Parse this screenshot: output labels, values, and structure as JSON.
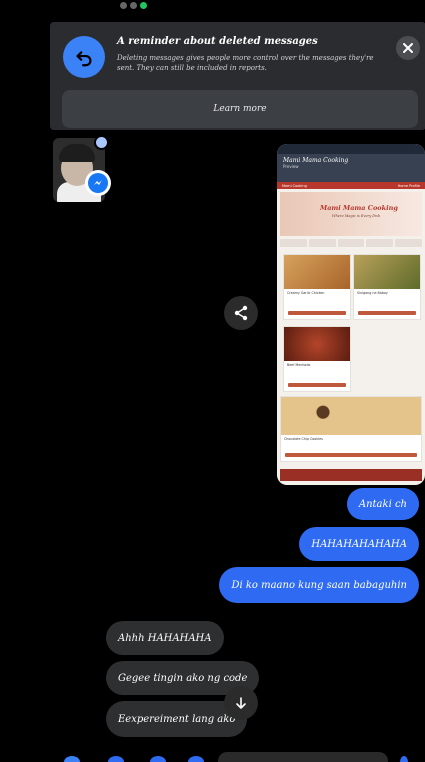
{
  "banner": {
    "title": "A reminder about deleted messages",
    "body": "Deleting messages gives people more control over the messages they're sent. They can still be included in reports.",
    "learn_more_label": "Learn more"
  },
  "shared_screenshot": {
    "app_title": "Mami Mama Cooking",
    "app_subtitle": "Preview",
    "nav_left": "Mami Cooking",
    "nav_right": "Home  Profile",
    "hero_title": "Mami Mama Cooking",
    "hero_tagline": "Where Magic is Every Dish",
    "recipes": [
      {
        "name": "Creamy Garlic Chicken"
      },
      {
        "name": "Sinigang na Baboy"
      },
      {
        "name": "Beef Mechado"
      },
      {
        "name": "Chocolate Chip Cookies"
      }
    ]
  },
  "messages": {
    "outgoing": [
      "Antaki ch",
      "HAHAHAHAHAHA",
      "Di ko maano kung saan babaguhin"
    ],
    "incoming": [
      "Ahhh HAHAHAHA",
      "Gegee tingin ako ng code",
      "Eexpereiment lang ako"
    ]
  },
  "colors": {
    "outgoing_bubble": "#2f6bf2",
    "incoming_bubble": "#2e2f31",
    "banner_bg": "#2a2c2f",
    "accent": "#3b82f6"
  }
}
